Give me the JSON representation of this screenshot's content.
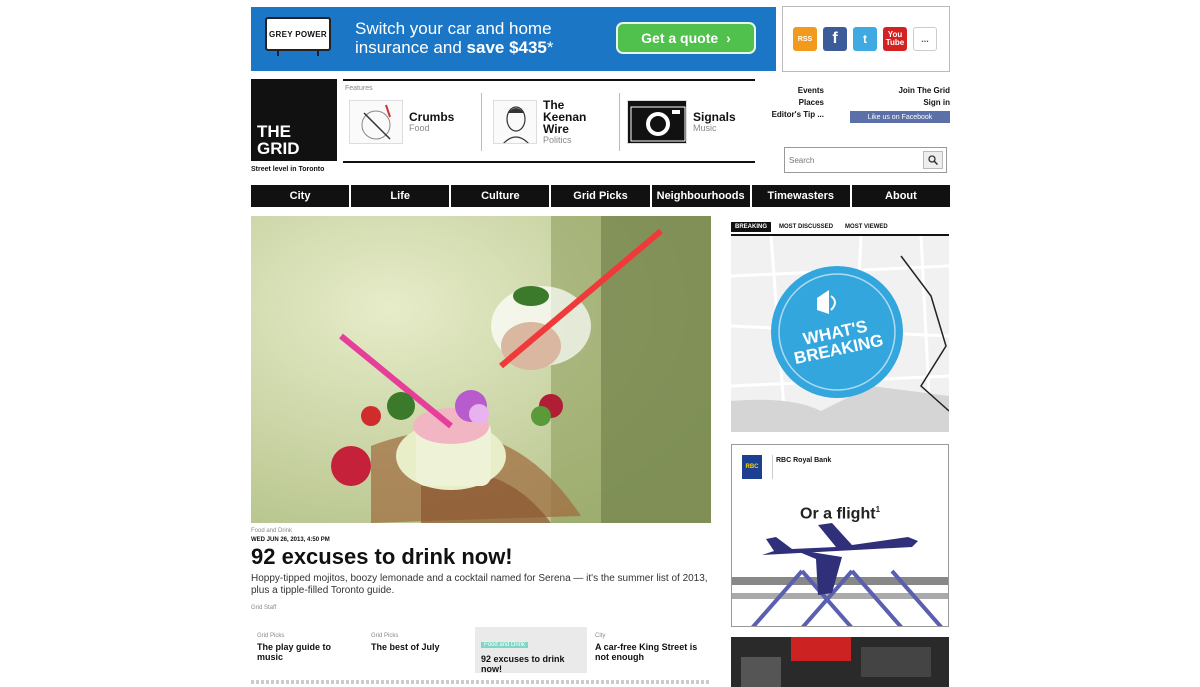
{
  "top_ad": {
    "logo_text": "GREY POWER",
    "line1": "Switch your car and home",
    "line2_prefix": "insurance and ",
    "line2_bold": "save $435",
    "line2_suffix": "*",
    "cta": "Get a quote",
    "cta_arrow": "›"
  },
  "social": [
    "RSS",
    "f",
    "t",
    "You Tube",
    "..."
  ],
  "brand": {
    "line1": "THE",
    "line2": "GRID",
    "tagline": "Street level in Toronto"
  },
  "features": {
    "label": "Features",
    "items": [
      {
        "title": "Crumbs",
        "sub": "Food"
      },
      {
        "title_lines": [
          "The",
          "Keenan",
          "Wire"
        ],
        "sub": "Politics"
      },
      {
        "title": "Signals",
        "sub": "Music"
      }
    ]
  },
  "quick_links": {
    "left": [
      "Events",
      "Places",
      "Editor's Tip ..."
    ],
    "right": [
      "Join The Grid",
      "Sign in"
    ],
    "facebook": "Like us on Facebook"
  },
  "search": {
    "placeholder": "Search",
    "button_icon": "magnifier-icon"
  },
  "nav": [
    "City",
    "Life",
    "Culture",
    "Grid Picks",
    "Neighbourhoods",
    "Timewasters",
    "About"
  ],
  "hero": {
    "kicker": "Food and Drink",
    "date": "WED JUN 26, 2013, 4:50 PM",
    "headline": "92 excuses to drink now!",
    "dek": "Hoppy-tipped mojitos, boozy lemonade and a cocktail named for Serena — it's the summer list of 2013, plus a tipple-filled Toronto guide.",
    "byline": "Grid Staff"
  },
  "related": [
    {
      "cat": "Grid Picks",
      "title": "The play guide to music"
    },
    {
      "cat": "Grid Picks",
      "title": "The best of July"
    },
    {
      "cat": "Food and Drink",
      "title": "92 excuses to drink now!"
    },
    {
      "cat": "City",
      "title": "A car-free King Street is not enough"
    }
  ],
  "sidebar": {
    "tabs": [
      "BREAKING",
      "MOST DISCUSSED",
      "MOST VIEWED"
    ],
    "breaking_lines": [
      "WHAT'S",
      "BREAKING"
    ],
    "rbc": {
      "name": "RBC Royal Bank",
      "logo": "RBC",
      "headline": "Or a flight",
      "footnote": "1"
    }
  },
  "colors": {
    "nav_bg": "#111111",
    "ad_blue": "#1b77c6",
    "cta_green": "#4fc14c",
    "breaking_blue": "#33a6de",
    "active_tag": "#7fd6c6",
    "rbc_blue": "#1c3f8f"
  }
}
